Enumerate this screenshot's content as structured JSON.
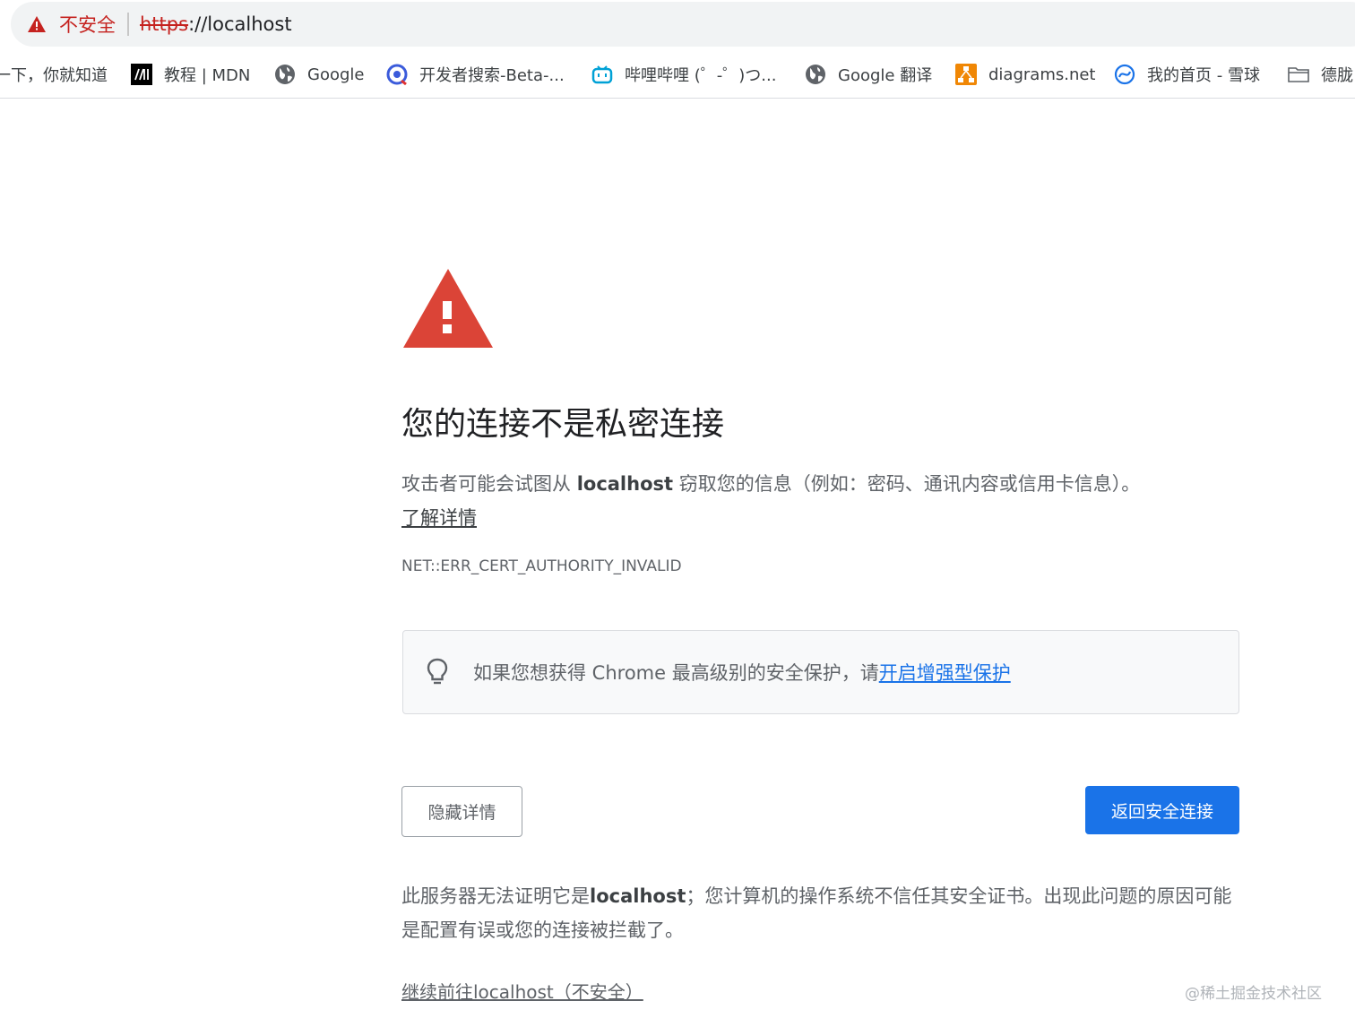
{
  "address_bar": {
    "security_label": "不安全",
    "url_scheme": "https",
    "url_rest": "://localhost"
  },
  "bookmarks": [
    {
      "label": "一下，你就知道",
      "icon": "none"
    },
    {
      "label": "教程 | MDN",
      "icon": "mdn-logo-icon"
    },
    {
      "label": "Google",
      "icon": "globe-icon"
    },
    {
      "label": "开发者搜索-Beta-...",
      "icon": "dev-search-icon"
    },
    {
      "label": "哔哩哔哩 (゜-゜)つ...",
      "icon": "bilibili-icon"
    },
    {
      "label": "Google 翻译",
      "icon": "globe-icon"
    },
    {
      "label": "diagrams.net",
      "icon": "diagrams-icon"
    },
    {
      "label": "我的首页 - 雪球",
      "icon": "xueqiu-icon"
    },
    {
      "label": "德胧",
      "icon": "folder-icon"
    }
  ],
  "interstitial": {
    "title": "您的连接不是私密连接",
    "message_before": "攻击者可能会试图从 ",
    "message_host": "localhost",
    "message_after": " 窃取您的信息（例如：密码、通讯内容或信用卡信息）。",
    "learn_more": "了解详情",
    "error_code": "NET::ERR_CERT_AUTHORITY_INVALID",
    "enhanced_text": "如果您想获得 Chrome 最高级别的安全保护，请",
    "enhanced_link": "开启增强型保护",
    "hide_details_button": "隐藏详情",
    "back_to_safety_button": "返回安全连接",
    "details_before": "此服务器无法证明它是",
    "details_host": "localhost",
    "details_after": "；您计算机的操作系统不信任其安全证书。出现此问题的原因可能是配置有误或您的连接被拦截了。",
    "proceed_link": "继续前往localhost（不安全）"
  },
  "watermark": "@稀土掘金技术社区",
  "colors": {
    "danger_red": "#db4437",
    "link_blue": "#1a73e8",
    "insecure_red": "#c5221f"
  }
}
